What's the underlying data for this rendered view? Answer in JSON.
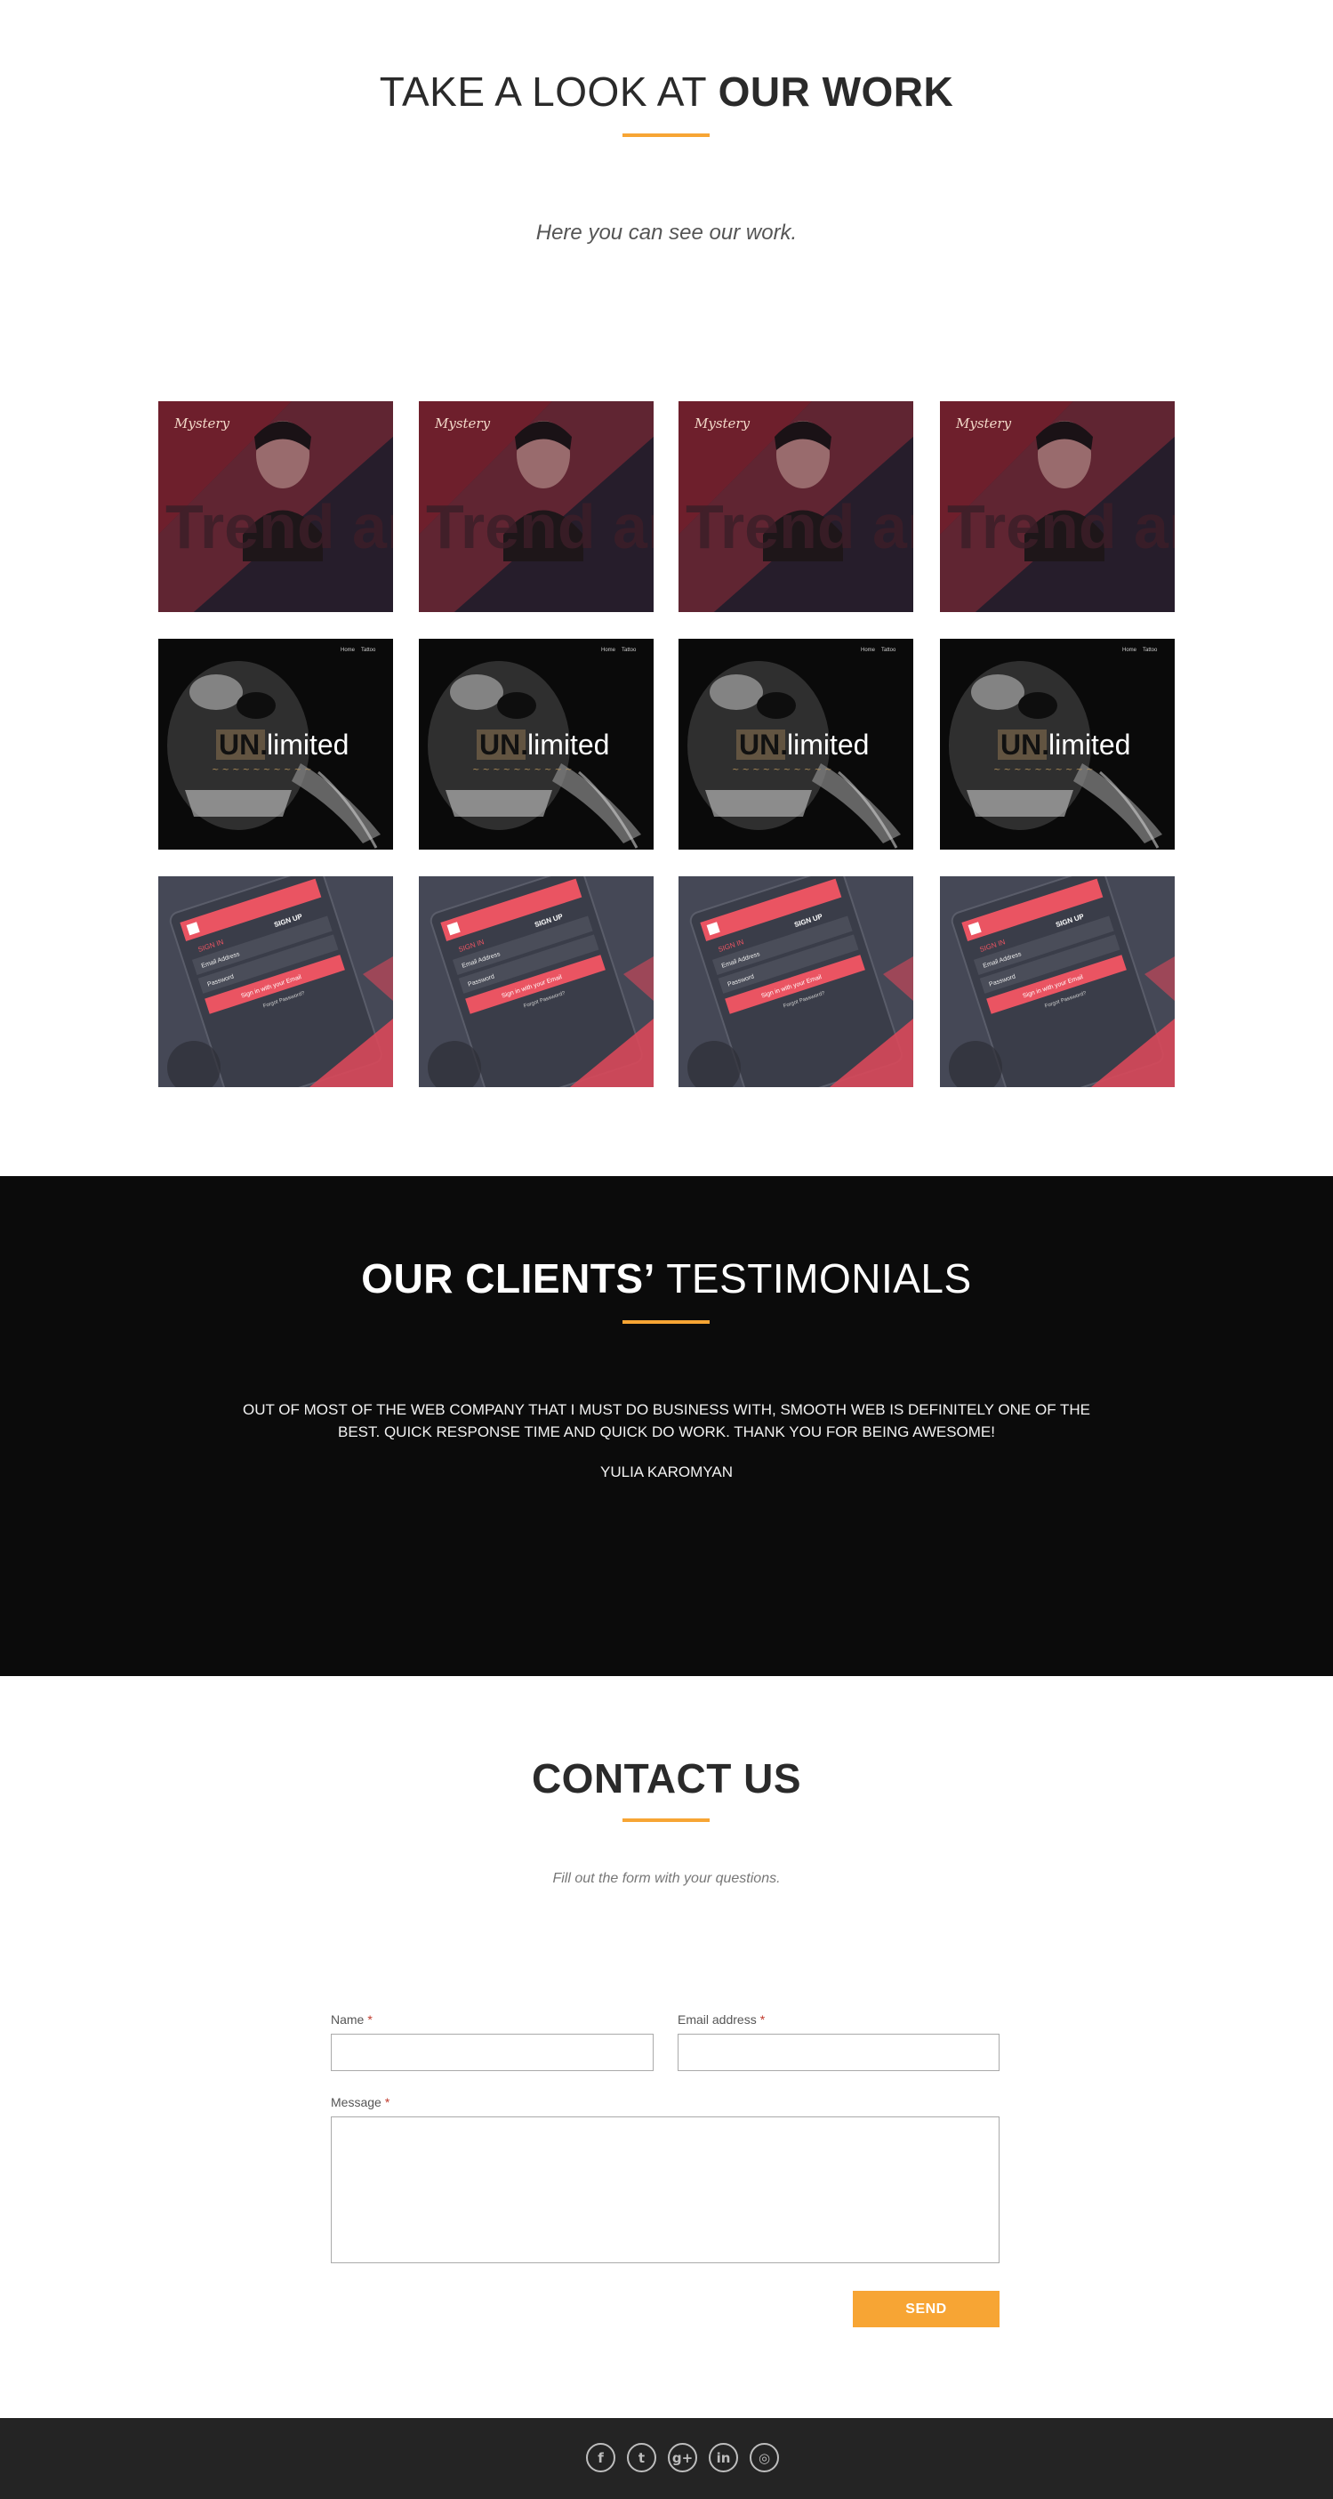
{
  "work": {
    "title_light": "TAKE A LOOK AT ",
    "title_bold": "OUR WORK",
    "subtitle": "Here you can see our work.",
    "tiles": [
      {
        "row": 1,
        "theme": "mystery",
        "caption": "Mystery",
        "big_text": "Trend ar"
      },
      {
        "row": 2,
        "theme": "unlimited",
        "brand_a": "UN.",
        "brand_b": "limited",
        "nav_a": "Home",
        "nav_b": "Tattoo"
      },
      {
        "row": 3,
        "theme": "app",
        "header": "SIGN UP",
        "tab": "SIGN IN",
        "field_a": "Email Address",
        "field_b": "Password",
        "cta": "Sign in with your Email",
        "link": "Forgot Password?"
      }
    ]
  },
  "testimonials": {
    "title_bold": "OUR CLIENTS’",
    "title_light": " TESTIMONIALS",
    "quote": "OUT OF MOST OF THE WEB COMPANY THAT I MUST DO BUSINESS WITH, SMOOTH WEB IS DEFINITELY ONE OF THE BEST. QUICK RESPONSE TIME AND QUICK DO WORK. THANK YOU FOR BEING AWESOME!",
    "author": "YULIA KAROMYAN"
  },
  "contact": {
    "title": "CONTACT US",
    "subtitle": "Fill out the form with your questions.",
    "name_label": "Name",
    "email_label": "Email address",
    "message_label": "Message",
    "required_mark": "*",
    "name_value": "",
    "email_value": "",
    "message_value": "",
    "send_label": "SEND"
  },
  "footer": {
    "social": [
      {
        "icon": "facebook-icon",
        "glyph": "f"
      },
      {
        "icon": "twitter-icon",
        "glyph": "t"
      },
      {
        "icon": "google-plus-icon",
        "glyph": "g+"
      },
      {
        "icon": "linkedin-icon",
        "glyph": "in"
      },
      {
        "icon": "dribbble-icon",
        "glyph": "◎"
      }
    ]
  },
  "colors": {
    "accent": "#f7a534",
    "dark_band": "#0b0b0b",
    "footer": "#242424",
    "required": "#c0392b"
  }
}
